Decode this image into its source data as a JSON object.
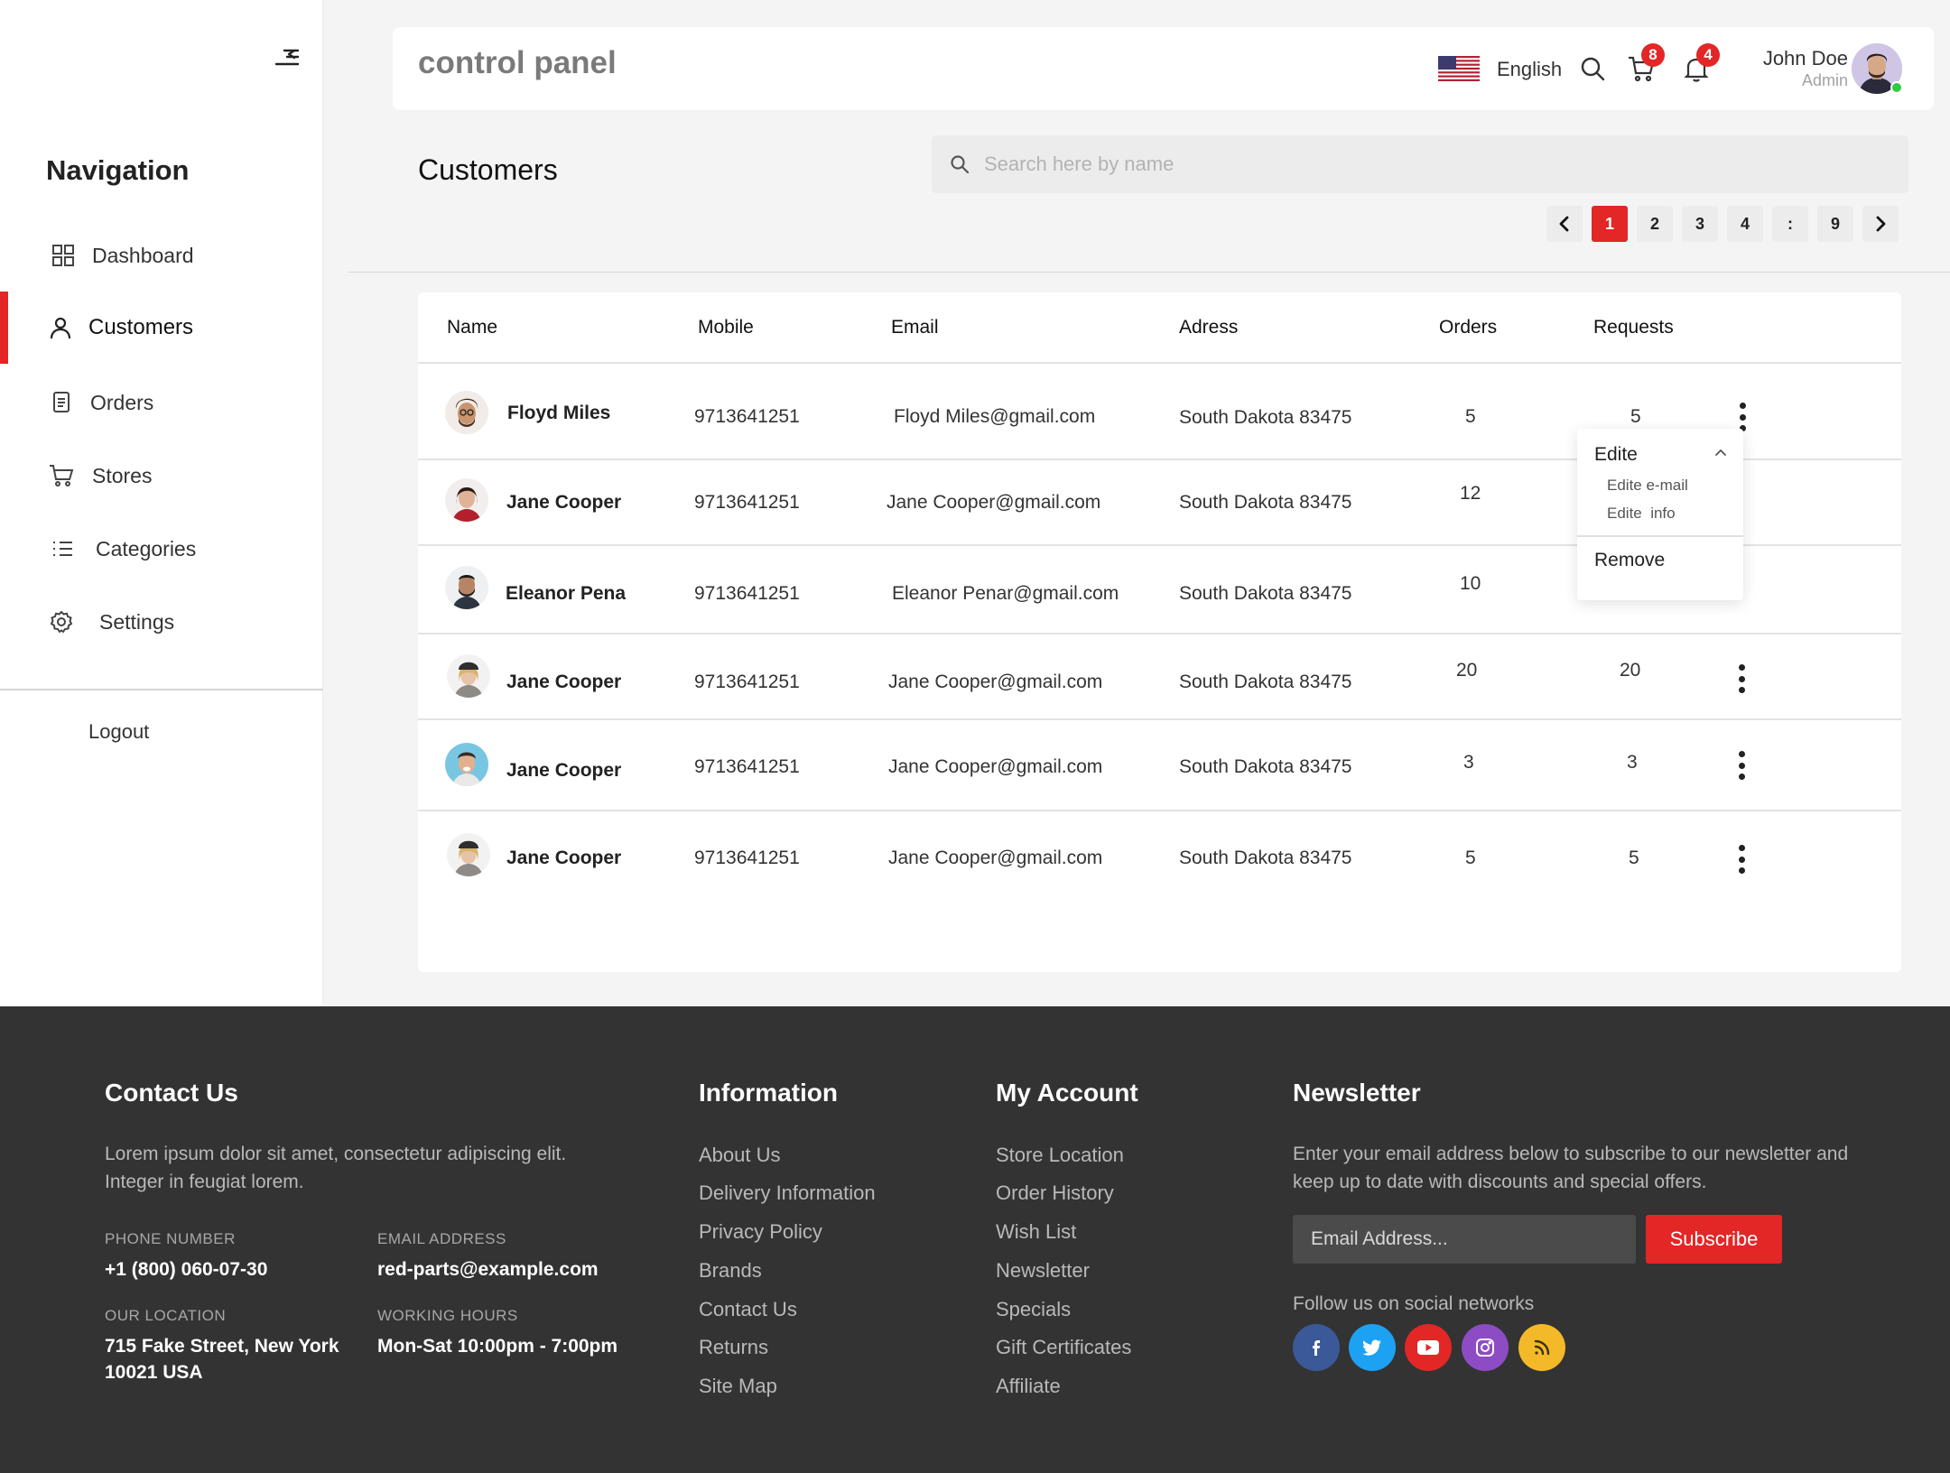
{
  "sidebar": {
    "title": "Navigation",
    "items": [
      {
        "label": "Dashboard",
        "icon": "grid-icon"
      },
      {
        "label": "Customers",
        "icon": "user-icon",
        "active": true
      },
      {
        "label": "Orders",
        "icon": "document-icon"
      },
      {
        "label": "Stores",
        "icon": "cart-icon"
      },
      {
        "label": "Categories",
        "icon": "list-icon"
      },
      {
        "label": "Settings",
        "icon": "gear-icon"
      }
    ],
    "logout": "Logout"
  },
  "header": {
    "title": "control panel",
    "language": "English",
    "cart_count": "8",
    "notification_count": "4",
    "user_name": "John Doe",
    "user_role": "Admin"
  },
  "page": {
    "title": "Customers",
    "search_placeholder": "Search here by name"
  },
  "pagination": {
    "pages": [
      "1",
      "2",
      "3",
      "4",
      ":",
      "9"
    ],
    "current": "1"
  },
  "table": {
    "columns": [
      "Name",
      "Mobile",
      "Email",
      "Adress",
      "Orders",
      "Requests"
    ],
    "rows": [
      {
        "name": "Floyd Miles",
        "mobile": "9713641251",
        "email": "Floyd Miles@gmail.com",
        "address": "South Dakota 83475",
        "orders": "5",
        "requests": "5"
      },
      {
        "name": "Jane Cooper",
        "mobile": "9713641251",
        "email": "Jane Cooper@gmail.com",
        "address": "South Dakota 83475",
        "orders": "12",
        "requests": ""
      },
      {
        "name": "Eleanor Pena",
        "mobile": "9713641251",
        "email": "Eleanor Penar@gmail.com",
        "address": "South Dakota 83475",
        "orders": "10",
        "requests": ""
      },
      {
        "name": "Jane Cooper",
        "mobile": "9713641251",
        "email": "Jane Cooper@gmail.com",
        "address": "South Dakota 83475",
        "orders": "20",
        "requests": "20"
      },
      {
        "name": "Jane Cooper",
        "mobile": "9713641251",
        "email": "Jane Cooper@gmail.com",
        "address": "South Dakota 83475",
        "orders": "3",
        "requests": "3"
      },
      {
        "name": "Jane Cooper",
        "mobile": "9713641251",
        "email": "Jane Cooper@gmail.com",
        "address": "South Dakota 83475",
        "orders": "5",
        "requests": "5"
      }
    ]
  },
  "dropdown": {
    "edit": "Edite",
    "edit_email": "Edite e-mail",
    "edit_info": "Edite  info",
    "remove": "Remove"
  },
  "footer": {
    "contact": {
      "title": "Contact Us",
      "text": "Lorem ipsum dolor sit amet, consectetur adipiscing elit. Integer in feugiat lorem.",
      "phone_label": "PHONE NUMBER",
      "phone": "+1 (800) 060-07-30",
      "email_label": "EMAIL ADDRESS",
      "email": "red-parts@example.com",
      "location_label": "OUR LOCATION",
      "location": "715 Fake Street, New York 10021 USA",
      "hours_label": "WORKING HOURS",
      "hours": "Mon-Sat 10:00pm - 7:00pm"
    },
    "information": {
      "title": "Information",
      "links": [
        "About Us",
        "Delivery Information",
        "Privacy Policy",
        "Brands",
        "Contact Us",
        "Returns",
        "Site Map"
      ]
    },
    "account": {
      "title": "My Account",
      "links": [
        "Store Location",
        "Order History",
        "Wish List",
        "Newsletter",
        "Specials",
        "Gift Certificates",
        "Affiliate"
      ]
    },
    "newsletter": {
      "title": "Newsletter",
      "text": "Enter your email address below to subscribe to our newsletter and keep up to date with discounts and special offers.",
      "placeholder": "Email Address...",
      "button": "Subscribe",
      "follow": "Follow us on social networks"
    },
    "social": [
      {
        "icon": "facebook-icon",
        "color": "#3b5998"
      },
      {
        "icon": "twitter-icon",
        "color": "#1da1f2"
      },
      {
        "icon": "youtube-icon",
        "color": "#e32626"
      },
      {
        "icon": "instagram-icon",
        "color": "#8d4cc4"
      },
      {
        "icon": "rss-icon",
        "color": "#f4b928"
      }
    ]
  },
  "colors": {
    "accent": "#e32626",
    "footer_bg": "#333333",
    "page_bg": "#f4f4f4"
  }
}
